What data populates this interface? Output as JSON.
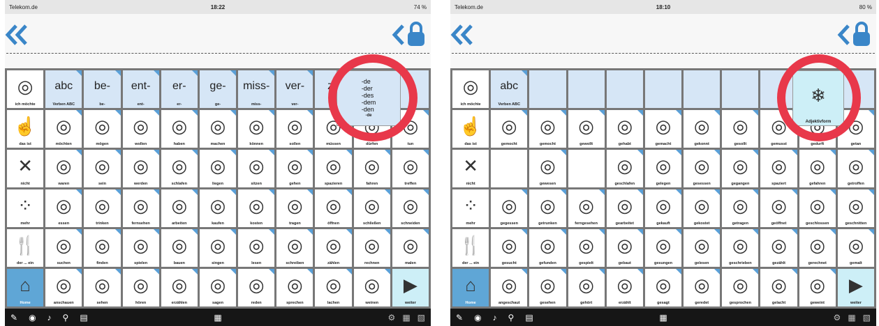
{
  "left": {
    "carrier": "Telekom.de",
    "time": "18:22",
    "battery": "74 %",
    "row1": [
      {
        "label": "ich möchte",
        "icon": "person-want-icon"
      },
      {
        "label": "Verben ABC",
        "icon": "abc-icon",
        "top": "abc"
      },
      {
        "label": "be-",
        "icon": "prefix-be-icon",
        "top": "be-"
      },
      {
        "label": "ent-",
        "icon": "prefix-ent-icon",
        "top": "ent-"
      },
      {
        "label": "er-",
        "icon": "prefix-er-icon",
        "top": "er-"
      },
      {
        "label": "ge-",
        "icon": "prefix-ge-icon",
        "top": "ge-"
      },
      {
        "label": "miss-",
        "icon": "prefix-miss-icon",
        "top": "miss-"
      },
      {
        "label": "ver-",
        "icon": "prefix-ver-icon",
        "top": "ver-"
      },
      {
        "label": "",
        "icon": "prefix-ze-icon",
        "top": "ze"
      }
    ],
    "popup": {
      "articles": [
        "-de",
        "-der",
        "-des",
        "-dem",
        "-den"
      ],
      "label": "-de"
    },
    "rows": [
      [
        "das ist",
        "möchten",
        "mögen",
        "wollen",
        "haben",
        "machen",
        "können",
        "sollen",
        "müssen",
        "dürfen",
        "tun"
      ],
      [
        "nicht",
        "waren",
        "sein",
        "werden",
        "schlafen",
        "liegen",
        "sitzen",
        "gehen",
        "spazieren",
        "fahren",
        "treffen"
      ],
      [
        "mehr",
        "essen",
        "trinken",
        "fernsehen",
        "arbeiten",
        "kaufen",
        "kosten",
        "tragen",
        "öffnen",
        "schließen",
        "schneiden"
      ],
      [
        "der ... ein",
        "suchen",
        "finden",
        "spielen",
        "bauen",
        "singen",
        "lesen",
        "schreiben",
        "zählen",
        "rechnen",
        "malen"
      ],
      [
        "Home",
        "anschauen",
        "sehen",
        "hören",
        "erzählen",
        "sagen",
        "reden",
        "sprechen",
        "lachen",
        "weinen",
        "weiter"
      ]
    ]
  },
  "right": {
    "carrier": "Telekom.de",
    "time": "18:10",
    "battery": "80 %",
    "row1": [
      {
        "label": "ich möchte"
      },
      {
        "label": "Verben ABC",
        "top": "abc"
      }
    ],
    "popup": {
      "label": "Adjektivform"
    },
    "rows": [
      [
        "das ist",
        "gemocht",
        "gemocht",
        "gewollt",
        "gehabt",
        "gemacht",
        "gekonnt",
        "gesollt",
        "gemusst",
        "gedurft",
        "getan"
      ],
      [
        "nicht",
        "",
        "gewesen",
        "",
        "geschlafen",
        "gelegen",
        "gesessen",
        "gegangen",
        "spaziert",
        "gefahren",
        "getroffen"
      ],
      [
        "mehr",
        "gegessen",
        "getrunken",
        "ferngesehen",
        "gearbeitet",
        "gekauft",
        "gekostet",
        "getragen",
        "geöffnet",
        "geschlossen",
        "geschnitten"
      ],
      [
        "der ... ein",
        "gesucht",
        "gefunden",
        "gespielt",
        "gebaut",
        "gesungen",
        "gelesen",
        "geschrieben",
        "gezählt",
        "gerechnet",
        "gemalt"
      ],
      [
        "Home",
        "angeschaut",
        "gesehen",
        "gehört",
        "erzählt",
        "gesagt",
        "geredet",
        "gesprochen",
        "gelacht",
        "geweint",
        "weiter"
      ]
    ]
  },
  "cell_glyphs": {
    "das ist": "☝",
    "nicht": "✕",
    "mehr": "⁘",
    "der ... ein": "🍴",
    "Home": "⌂",
    "weiter": "▶"
  },
  "colors": {
    "highlight_ring": "#e8384a",
    "nav_blue": "#3a86c8",
    "grid_border": "#777777",
    "folder_corner": "#5aa0d8"
  }
}
